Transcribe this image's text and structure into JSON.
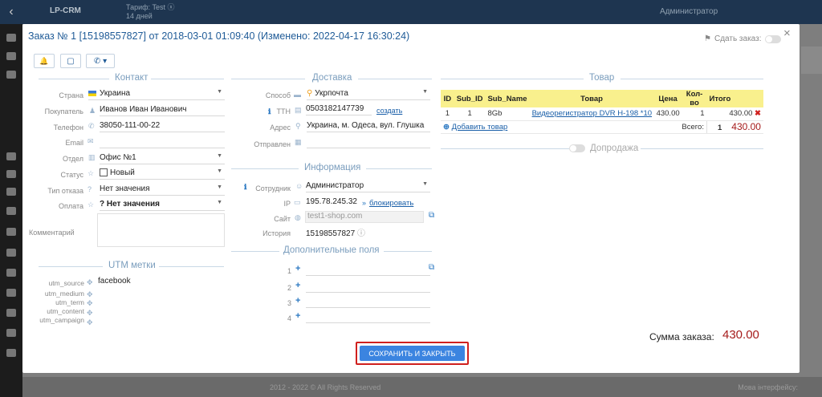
{
  "app": {
    "logo": "LP-CRM",
    "tarif_line1": "Тариф: Test ⓧ",
    "tarif_line2": "14 дней",
    "admin": "Администратор",
    "footer_copy": "2012 - 2022 © All Rights Reserved",
    "footer_mode": "Мова інтерфейсу:"
  },
  "modal": {
    "title": "Заказ № 1 [15198557827] от 2018-03-01 01:09:40 (Изменено: 2022-04-17 16:30:24)",
    "sdat_label": "Сдать заказ:",
    "close": "×"
  },
  "toolbar": {
    "bell": "🔔",
    "square": "▢",
    "phone": "✆ ▾"
  },
  "contact": {
    "title": "Контакт",
    "rows": [
      {
        "label": "Страна",
        "value": "Украина"
      },
      {
        "label": "Покупатель",
        "value": "Иванов Иван Иванович"
      },
      {
        "label": "Телефон",
        "value": "38050-111-00-22"
      },
      {
        "label": "Email",
        "value": ""
      },
      {
        "label": "Отдел",
        "value": "Офис №1"
      },
      {
        "label": "Статус",
        "value": "Новый"
      },
      {
        "label": "Тип отказа",
        "value": "Нет значения"
      },
      {
        "label": "Оплата",
        "value": "? Нет значения"
      },
      {
        "label": "Комментарий",
        "value": ""
      }
    ]
  },
  "utm": {
    "title": "UTM метки",
    "rows": [
      {
        "label": "utm_source",
        "value": "facebook"
      },
      {
        "label": "utm_medium",
        "value": ""
      },
      {
        "label": "utm_term",
        "value": ""
      },
      {
        "label": "utm_content",
        "value": ""
      },
      {
        "label": "utm_campaign",
        "value": ""
      }
    ]
  },
  "delivery": {
    "title": "Доставка",
    "method_label": "Способ",
    "method_value": "Укрпочта",
    "ttn_label": "ТТН",
    "ttn_value": "0503182147739",
    "ttn_create": "создать",
    "address_label": "Адрес",
    "address_value": "Украина, м. Одеса, вул. Глушка",
    "sent_label": "Отправлен",
    "sent_value": ""
  },
  "info": {
    "title": "Информация",
    "employee_label": "Сотрудник",
    "employee_value": "Администратор",
    "ip_label": "IP",
    "ip_value": "195.78.245.32",
    "ip_block": "блокировать",
    "site_label": "Сайт",
    "site_value": "test1-shop.com",
    "history_label": "История",
    "history_value": "15198557827"
  },
  "extra": {
    "title": "Дополнительные поля",
    "rows": [
      "1",
      "2",
      "3",
      "4"
    ]
  },
  "goods": {
    "title": "Товар",
    "headers": [
      "ID",
      "Sub_ID",
      "Sub_Name",
      "Товар",
      "Цена",
      "Кол-во",
      "Итого"
    ],
    "row": [
      "1",
      "1",
      "8Gb",
      "Видеорегистратор DVR H-198 *10",
      "430.00",
      "1",
      "430.00"
    ],
    "add": "Добавить товар",
    "total_label": "Всего:",
    "total_qty": "1",
    "total_sum": "430.00",
    "upsell": "Допродажа"
  },
  "summary": {
    "label": "Сумма заказа:",
    "value": "430.00"
  },
  "save_button": "СОХРАНИТЬ И ЗАКРЫТЬ",
  "colors": {
    "accent": "#1f5b97",
    "sum": "#a51b1b",
    "save": "#3b84e0",
    "highlight": "#d0201e",
    "table_head": "#f9f08d"
  }
}
